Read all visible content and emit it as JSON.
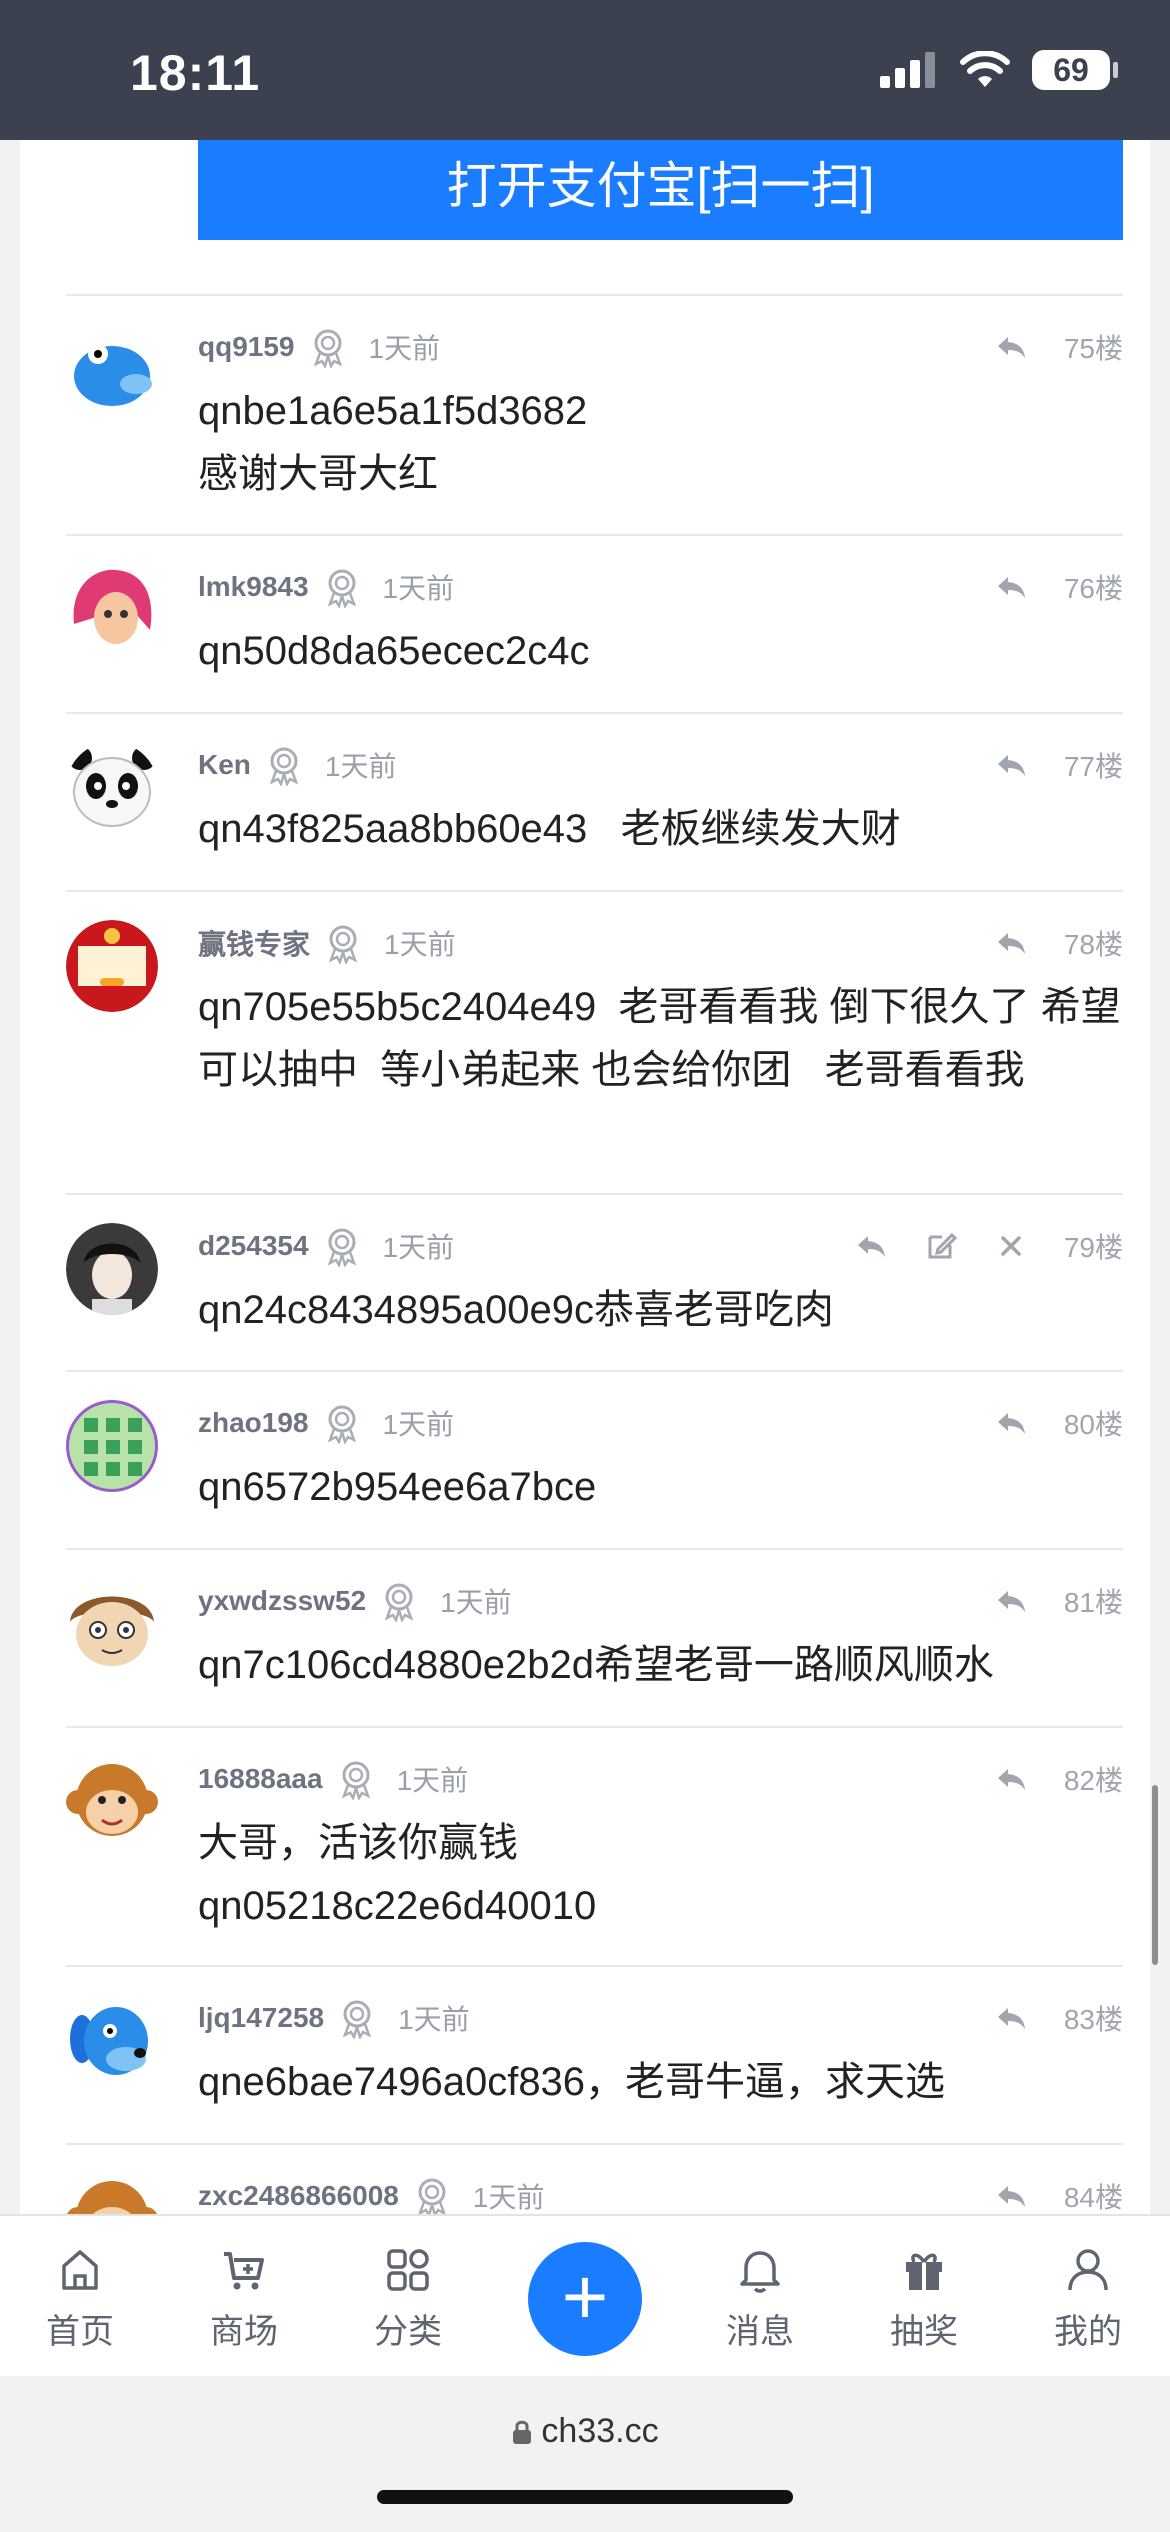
{
  "status": {
    "time": "18:11",
    "battery": "69"
  },
  "banner": {
    "text": "打开支付宝[扫一扫]"
  },
  "comments": [
    {
      "user": "qq9159",
      "time": "1天前",
      "floor": "75楼",
      "text": "qnbe1a6e5a1f5d3682\n感谢大哥大红"
    },
    {
      "user": "lmk9843",
      "time": "1天前",
      "floor": "76楼",
      "text": "qn50d8da65ecec2c4c"
    },
    {
      "user": "Ken",
      "time": "1天前",
      "floor": "77楼",
      "text": "qn43f825aa8bb60e43   老板继续发大财"
    },
    {
      "user": "赢钱专家",
      "time": "1天前",
      "floor": "78楼",
      "text": "qn705e55b5c2404e49  老哥看看我 倒下很久了 希望可以抽中  等小弟起来 也会给你团   老哥看看我"
    },
    {
      "user": "d254354",
      "time": "1天前",
      "floor": "79楼",
      "text": "qn24c8434895a00e9c恭喜老哥吃肉"
    },
    {
      "user": "zhao198",
      "time": "1天前",
      "floor": "80楼",
      "text": "qn6572b954ee6a7bce"
    },
    {
      "user": "yxwdzssw52",
      "time": "1天前",
      "floor": "81楼",
      "text": "qn7c106cd4880e2b2d希望老哥一路顺风顺水"
    },
    {
      "user": "16888aaa",
      "time": "1天前",
      "floor": "82楼",
      "text": "大哥，活该你赢钱\nqn05218c22e6d40010"
    },
    {
      "user": "ljq147258",
      "time": "1天前",
      "floor": "83楼",
      "text": "qne6bae7496a0cf836，老哥牛逼，求天选"
    },
    {
      "user": "zxc2486866008",
      "time": "1天前",
      "floor": "84楼",
      "text": ""
    }
  ],
  "tabs": [
    {
      "label": "首页",
      "icon": "home-icon"
    },
    {
      "label": "商场",
      "icon": "cart-icon"
    },
    {
      "label": "分类",
      "icon": "grid-icon"
    },
    {
      "label": "消息",
      "icon": "bell-icon"
    },
    {
      "label": "抽奖",
      "icon": "gift-icon"
    },
    {
      "label": "我的",
      "icon": "user-icon"
    }
  ],
  "browser": {
    "url": "ch33.cc"
  },
  "colors": {
    "accent": "#1a7cff",
    "statusbar": "#3c4150"
  }
}
